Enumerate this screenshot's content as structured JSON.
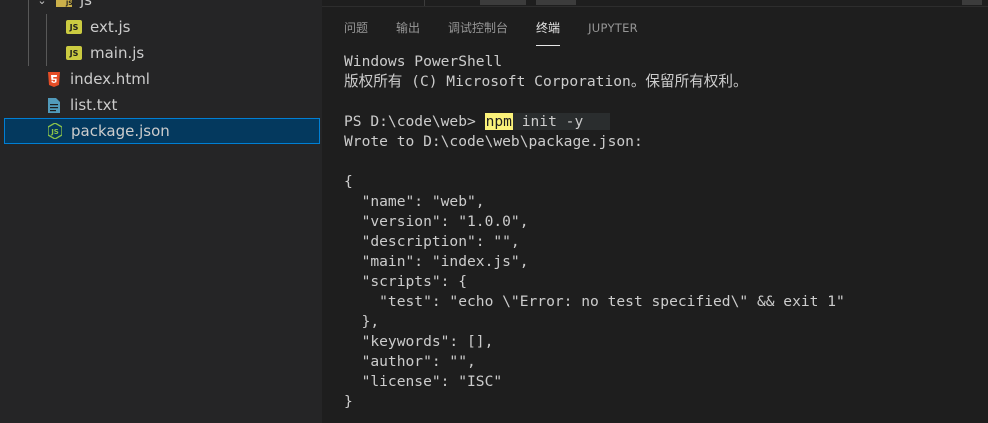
{
  "explorer": {
    "folder_label": "js",
    "files": [
      {
        "name": "ext.js",
        "icon": "js-file-icon"
      },
      {
        "name": "main.js",
        "icon": "js-file-icon"
      },
      {
        "name": "index.html",
        "icon": "html-file-icon"
      },
      {
        "name": "list.txt",
        "icon": "text-file-icon"
      },
      {
        "name": "package.json",
        "icon": "nodejs-file-icon"
      }
    ]
  },
  "panel": {
    "tabs": [
      "问题",
      "输出",
      "调试控制台",
      "终端",
      "JUPYTER"
    ],
    "active_tab": "终端"
  },
  "terminal": {
    "lines": [
      "Windows PowerShell",
      "版权所有 (C) Microsoft Corporation。保留所有权利。",
      "",
      "",
      "Wrote to D:\\code\\web\\package.json:",
      "",
      "{",
      "  \"name\": \"web\",",
      "  \"version\": \"1.0.0\",",
      "  \"description\": \"\",",
      "  \"main\": \"index.js\",",
      "  \"scripts\": {",
      "    \"test\": \"echo \\\"Error: no test specified\\\" && exit 1\"",
      "  },",
      "  \"keywords\": [],",
      "  \"author\": \"\",",
      "  \"license\": \"ISC\"",
      "}"
    ],
    "prompt": "PS D:\\code\\web> ",
    "command": "npm",
    "command_args": " init -y"
  },
  "colors": {
    "sidebar_bg": "#252526",
    "selection_bg": "#04395e",
    "selection_border": "#007fd4",
    "terminal_bg": "#1e1e1e",
    "js_icon": "#cbcb41",
    "html_icon": "#e44d26",
    "txt_icon": "#519aba",
    "node_icon": "#8bc34a"
  }
}
